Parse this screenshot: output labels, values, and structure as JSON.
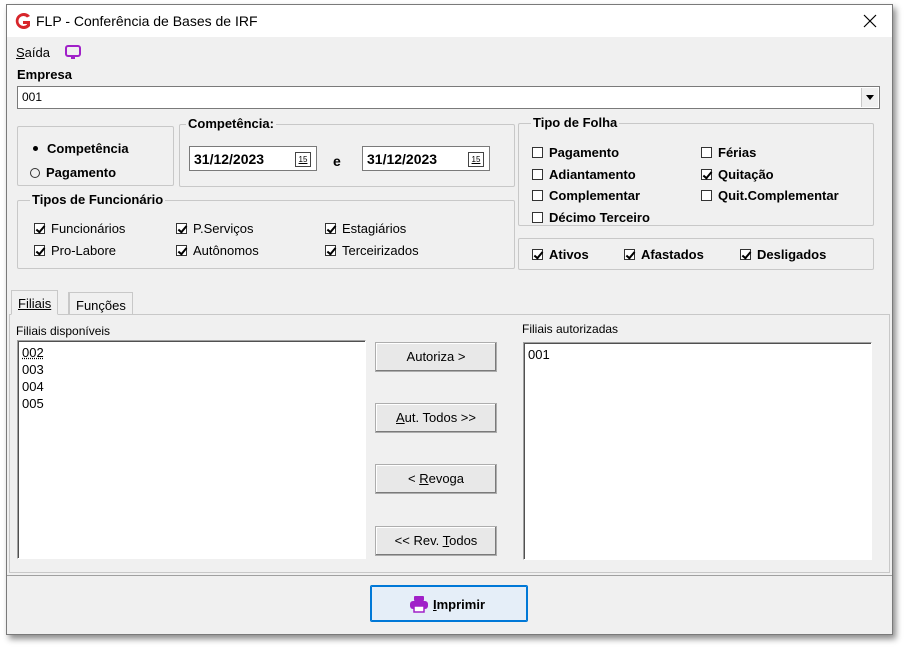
{
  "window": {
    "title": "FLP - Conferência de Bases de IRF"
  },
  "menu": {
    "saida_prefix": "S",
    "saida_rest": "aída"
  },
  "empresa": {
    "label": "Empresa",
    "value": "001"
  },
  "periodo": {
    "options": [
      {
        "label": "Competência",
        "selected": true
      },
      {
        "label": "Pagamento",
        "selected": false
      }
    ]
  },
  "competencia": {
    "label": "Competência:",
    "from": "31/12/2023",
    "separator": "e",
    "to": "31/12/2023",
    "cal_label": "15"
  },
  "tipo_folha": {
    "label": "Tipo de Folha",
    "items": [
      {
        "label": "Pagamento",
        "checked": false
      },
      {
        "label": "Adiantamento",
        "checked": false
      },
      {
        "label": "Complementar",
        "checked": false
      },
      {
        "label": "Décimo Terceiro",
        "checked": false
      },
      {
        "label": "Férias",
        "checked": false
      },
      {
        "label": "Quitação",
        "checked": true
      },
      {
        "label": "Quit.Complementar",
        "checked": false
      }
    ]
  },
  "tipos_funcionario": {
    "label": "Tipos de Funcionário",
    "items": [
      {
        "label": "Funcionários",
        "checked": true
      },
      {
        "label": "Pro-Labore",
        "checked": true
      },
      {
        "label": "P.Serviços",
        "checked": true
      },
      {
        "label": "Autônomos",
        "checked": true
      },
      {
        "label": "Estagiários",
        "checked": true
      },
      {
        "label": "Terceirizados",
        "checked": true
      }
    ]
  },
  "situacao": {
    "items": [
      {
        "label": "Ativos",
        "checked": true
      },
      {
        "label": "Afastados",
        "checked": true
      },
      {
        "label": "Desligados",
        "checked": true
      }
    ]
  },
  "tabs": [
    {
      "label": "Filiais",
      "active": true
    },
    {
      "label": "Funções",
      "active": false
    }
  ],
  "filiais": {
    "disponiveis_label": "Filiais disponíveis",
    "disponiveis": [
      "002",
      "003",
      "004",
      "005"
    ],
    "autorizadas_label": "Filiais autorizadas",
    "autorizadas": [
      "001"
    ]
  },
  "buttons": {
    "autoriza_pre": "",
    "autoriza_hk": "",
    "autoriza_post": "Autoriza >",
    "aut_todos_pre": "",
    "aut_todos_hk": "A",
    "aut_todos_post": "ut. Todos >>",
    "revoga_pre": "< ",
    "revoga_hk": "R",
    "revoga_post": "evoga",
    "rev_todos_pre": "<< Rev. ",
    "rev_todos_hk": "T",
    "rev_todos_post": "odos",
    "imprimir_hk": "I",
    "imprimir_post": "mprimir"
  },
  "colors": {
    "logo": "#d7262b",
    "monitor_icon": "#a020c8",
    "printer_icon": "#a020c8",
    "focus_border": "#0078d7"
  }
}
